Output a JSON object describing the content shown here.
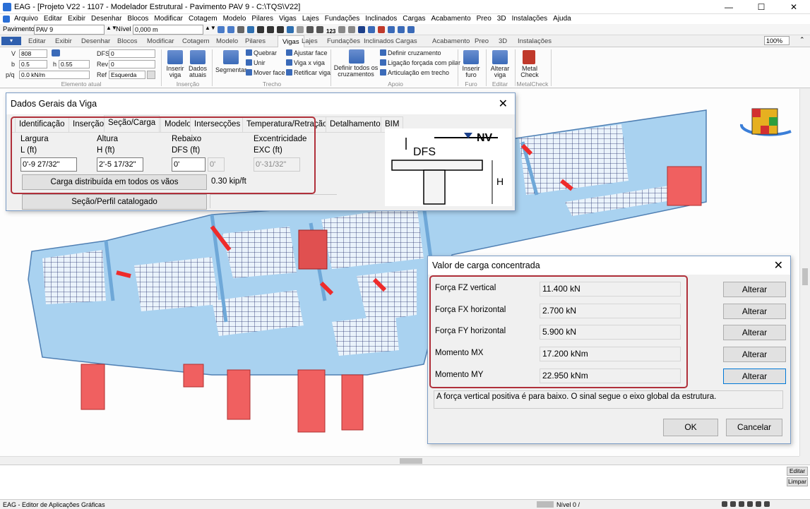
{
  "window": {
    "title": "EAG - [Projeto V22 - 1107 - Modelador Estrutural - Pavimento PAV 9 - C:\\TQS\\V22]",
    "minimize": "—",
    "maximize": "☐",
    "close": "✕"
  },
  "menu": [
    "Arquivo",
    "Editar",
    "Exibir",
    "Desenhar",
    "Blocos",
    "Modificar",
    "Cotagem",
    "Modelo",
    "Pilares",
    "Vigas",
    "Lajes",
    "Fundações",
    "Inclinados",
    "Cargas",
    "Acabamento",
    "Preo",
    "3D",
    "Instalações",
    "Ajuda"
  ],
  "quickbar": {
    "pavimento_label": "Pavimento",
    "pavimento_value": "PAV 9",
    "nivel_label": "Nível",
    "nivel_value": "0,000 m",
    "num_icon_text": "123"
  },
  "ribbon_tabs": {
    "file_tab": "",
    "tabs": [
      "Editar",
      "Exibir",
      "Desenhar",
      "Blocos",
      "Modificar",
      "Cotagem",
      "Modelo",
      "Pilares",
      "Vigas",
      "Lajes",
      "Fundações",
      "Inclinados",
      "Cargas",
      "Acabamento",
      "Preo",
      "3D",
      "Instalações"
    ],
    "active": "Vigas",
    "zoom": "100%"
  },
  "ribbon": {
    "elemento_atual": {
      "v_label": "V",
      "v_value": "808",
      "b_label": "b",
      "b_value": "0.5",
      "h_label": "h",
      "h_value": "0.55",
      "pq_label": "p/q",
      "pq_value": "0.0 kN/m",
      "dfs_label": "DFS",
      "dfs_value": "0",
      "rev_label": "Rev",
      "rev_value": "0",
      "ref_label": "Ref",
      "ref_value": "Esquerda",
      "group": "Elemento atual"
    },
    "insercao": {
      "inserir_viga": "Inserir viga",
      "dados_atuais": "Dados atuais",
      "group": "Inserção"
    },
    "trecho": {
      "segmentar": "Segmentar",
      "items": [
        "Quebrar",
        "Unir",
        "Mover face",
        "Ajustar face",
        "Viga x viga",
        "Retificar viga"
      ],
      "group": "Trecho"
    },
    "apoio": {
      "definir_todos": "Definir todos os cruzamentos",
      "items": [
        "Definir cruzamento",
        "Ligação forçada com pilar",
        "Articulação em trecho"
      ],
      "group": "Apoio"
    },
    "furo": {
      "inserir_furo": "Inserir furo",
      "group": "Furo"
    },
    "editar": {
      "alterar_viga": "Alterar viga",
      "group": "Editar"
    },
    "metalcheck": {
      "metal_check": "Metal Check",
      "group": "MetalCheck"
    }
  },
  "dialog_viga": {
    "title": "Dados Gerais da Viga",
    "tabs": [
      "Identificação",
      "Inserção",
      "Seção/Carga",
      "Modelo",
      "Intersecções",
      "Temperatura/Retração",
      "Detalhamento",
      "BIM"
    ],
    "active_tab": "Seção/Carga",
    "largura_label": "Largura",
    "largura_unit": "L (ft)",
    "largura_value": "0'-9 27/32\"",
    "altura_label": "Altura",
    "altura_unit": "H (ft)",
    "altura_value": "2'-5 17/32\"",
    "rebaixo_label": "Rebaixo",
    "rebaixo_unit": "DFS (ft)",
    "rebaixo_value": "0'",
    "rebaixo_value2": "0'",
    "exc_label": "Excentricidade",
    "exc_unit": "EXC (ft)",
    "exc_value": "0'-31/32\"",
    "carga_button": "Carga distribuída em todos os vãos",
    "carga_value": "0.30 kip/ft",
    "secao_button": "Seção/Perfil catalogado",
    "diagram": {
      "nv": "NV",
      "dfs": "DFS",
      "h": "H"
    }
  },
  "dialog_carga": {
    "title": "Valor de carga concentrada",
    "rows": [
      {
        "label": "Força FZ vertical",
        "value": "11.400 kN",
        "button": "Alterar"
      },
      {
        "label": "Força FX horizontal",
        "value": "2.700 kN",
        "button": "Alterar"
      },
      {
        "label": "Força FY horizontal",
        "value": "5.900 kN",
        "button": "Alterar"
      },
      {
        "label": "Momento MX",
        "value": "17.200 kNm",
        "button": "Alterar"
      },
      {
        "label": "Momento MY",
        "value": "22.950 kNm",
        "button": "Alterar"
      }
    ],
    "note": "A força vertical positiva é para baixo. O sinal segue o eixo global da estrutura.",
    "ok": "OK",
    "cancel": "Cancelar"
  },
  "command": {
    "editar_button": "Editar",
    "limpar_button": "Limpar"
  },
  "status": {
    "app": "EAG - Editor de Aplicações Gráficas",
    "nivel": "Nível 0 /"
  },
  "colors": {
    "accent": "#0078d7",
    "highlight_red": "#b0303a",
    "pillar_red": "#f06060",
    "slab_blue": "#a9d2f0"
  }
}
